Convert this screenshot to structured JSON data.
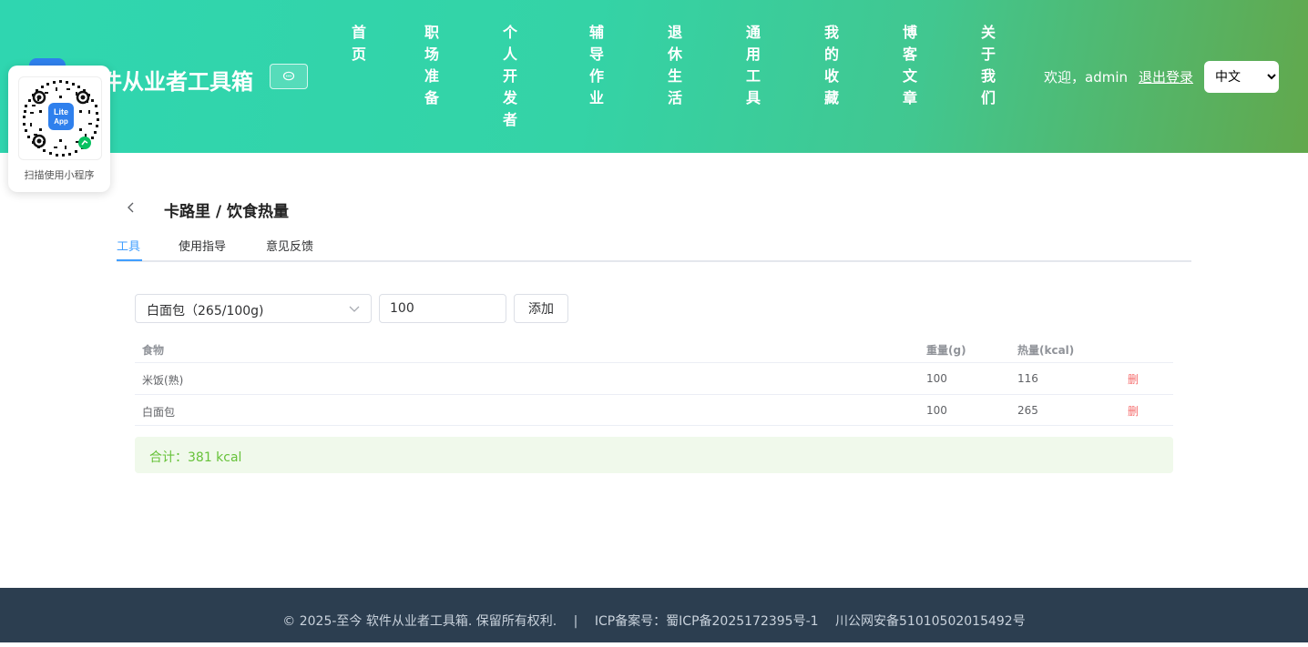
{
  "header": {
    "site_title": "件从业者工具箱",
    "nav": [
      "首页",
      "职场准备",
      "个人开发者",
      "辅导作业",
      "退休生活",
      "通用工具",
      "我的收藏",
      "博客文章",
      "关于我们"
    ],
    "welcome": "欢迎，admin",
    "logout": "退出登录",
    "language": "中文",
    "language_options": [
      "中文"
    ]
  },
  "qr": {
    "badge_line1": "Lite",
    "badge_line2": "App",
    "caption": "扫描使用小程序"
  },
  "page": {
    "title": "卡路里 / 饮食热量",
    "tabs": [
      "工具",
      "使用指导",
      "意见反馈"
    ]
  },
  "tool": {
    "food_select": "白面包（265/100g)",
    "weight_value": "100",
    "add_label": "添加",
    "columns": [
      "食物",
      "重量(g)",
      "热量(kcal)"
    ],
    "rows": [
      {
        "food": "米饭(熟)",
        "weight": "100",
        "kcal": "116",
        "delete": "删"
      },
      {
        "food": "白面包",
        "weight": "100",
        "kcal": "265",
        "delete": "删"
      }
    ],
    "total": "合计：381 kcal"
  },
  "footer": {
    "copyright": "© 2025-至今 软件从业者工具箱. 保留所有权利.",
    "separator": "|",
    "icp": "ICP备案号：蜀ICP备2025172395号-1",
    "police": "川公网安备51010502015492号"
  },
  "colors": {
    "accent": "#409eff",
    "danger": "#f56c6c",
    "success": "#67c23a",
    "footer_bg": "#2c3e50"
  }
}
